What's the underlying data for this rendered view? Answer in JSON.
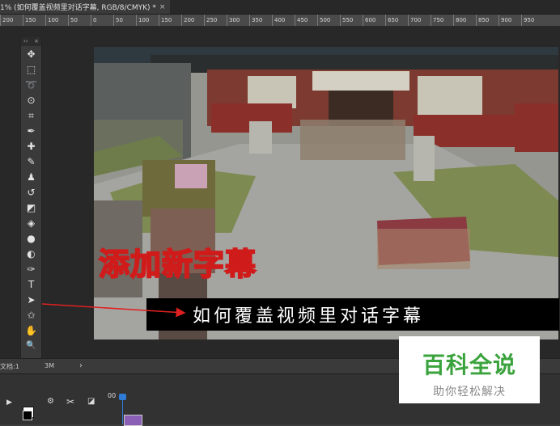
{
  "document_tab": {
    "title": "1% (如何覆盖视频里对话字幕, RGB/8/CMYK) *",
    "close_glyph": "×"
  },
  "ruler": {
    "ticks": [
      "200",
      "150",
      "100",
      "50",
      "0",
      "50",
      "100",
      "150",
      "200",
      "250",
      "300",
      "350",
      "400",
      "450",
      "500",
      "550",
      "600",
      "650",
      "700",
      "750",
      "800",
      "850",
      "900",
      "950"
    ]
  },
  "toolbar": {
    "grip_left": "››",
    "grip_right": "×",
    "tools": [
      {
        "name": "move-tool-icon",
        "glyph": "✥"
      },
      {
        "name": "marquee-tool-icon",
        "glyph": "⬚"
      },
      {
        "name": "lasso-tool-icon",
        "glyph": "➰"
      },
      {
        "name": "quick-selection-tool-icon",
        "glyph": "⊙"
      },
      {
        "name": "crop-tool-icon",
        "glyph": "⌗"
      },
      {
        "name": "eyedropper-tool-icon",
        "glyph": "✒"
      },
      {
        "name": "healing-brush-tool-icon",
        "glyph": "✚"
      },
      {
        "name": "brush-tool-icon",
        "glyph": "✎"
      },
      {
        "name": "clone-stamp-tool-icon",
        "glyph": "♟"
      },
      {
        "name": "history-brush-tool-icon",
        "glyph": "↺"
      },
      {
        "name": "eraser-tool-icon",
        "glyph": "◩"
      },
      {
        "name": "paint-bucket-tool-icon",
        "glyph": "◈"
      },
      {
        "name": "blur-tool-icon",
        "glyph": "●"
      },
      {
        "name": "dodge-tool-icon",
        "glyph": "◐"
      },
      {
        "name": "pen-tool-icon",
        "glyph": "✑"
      },
      {
        "name": "type-tool-icon",
        "glyph": "T"
      },
      {
        "name": "path-selection-tool-icon",
        "glyph": "➤"
      },
      {
        "name": "shape-tool-icon",
        "glyph": "✩"
      },
      {
        "name": "hand-tool-icon",
        "glyph": "✋"
      },
      {
        "name": "zoom-tool-icon",
        "glyph": "🔍"
      },
      {
        "name": "more-tools-icon",
        "glyph": "•••"
      }
    ]
  },
  "canvas": {
    "overlay_title": "添加新字幕",
    "subtitle": "如何覆盖视频里对话字幕"
  },
  "status_bar": {
    "doc_info": "文档:1",
    "size_suffix": "3M",
    "arrow": "›"
  },
  "timeline": {
    "time_label": "00",
    "play_glyph": "▶",
    "scissors_glyph": "✂"
  },
  "watermark": {
    "title": "百科全说",
    "subtitle": "助你轻松解决"
  },
  "colors": {
    "annotation_red": "#d01b1b",
    "arrow_red": "#e02020",
    "watermark_green": "#3aa33d",
    "foreground_swatch": "#000000",
    "background_swatch": "#ffffff"
  }
}
